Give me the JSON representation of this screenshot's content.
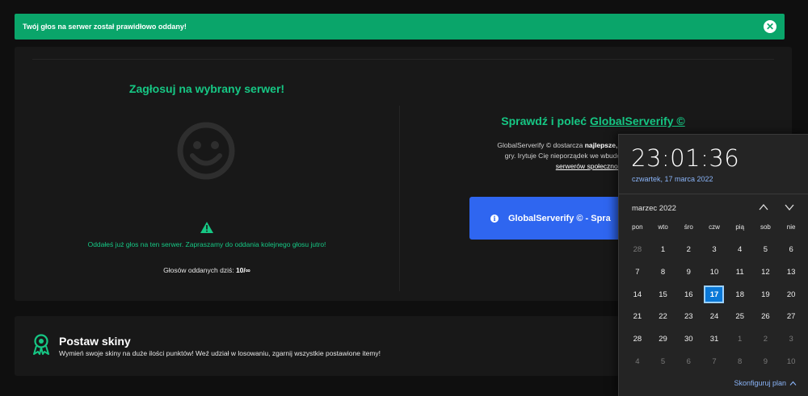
{
  "toast": {
    "message": "Twój głos na serwer został prawidłowo oddany!",
    "close_symbol": "✕"
  },
  "vote": {
    "title": "Zagłosuj na wybrany serwer!",
    "already_voted": "Oddałeś już głos na ten serwer. Zapraszamy do oddania kolejnego głosu jutro!",
    "count_label": "Głosów oddanych dziś:",
    "count_value": "10/∞"
  },
  "promo": {
    "title_prefix": "Sprawdź i poleć",
    "title_link": "GlobalServerify ©",
    "desc_1": "GlobalServerify © dostarcza",
    "desc_bold": "najlepsze, sprawdzone, polskie i",
    "desc_2": "gry. Irytuje Cię nieporządek we wbudowanej wyszukiwarce",
    "desc_link": "serwerów społeczności d",
    "button_label": "GlobalServerify © - Spra"
  },
  "skins": {
    "title": "Postaw skiny",
    "description": "Wymień swoje skiny na duże ilości punktów! Weź udział w losowaniu, zgarnij wszystkie postawione itemy!"
  },
  "calendar": {
    "time": "23:01:36",
    "date": "czwartek, 17 marca 2022",
    "month": "marzec 2022",
    "weekdays": [
      "pon",
      "wto",
      "śro",
      "czw",
      "pią",
      "sob",
      "nie"
    ],
    "days": [
      {
        "d": "28",
        "other": true
      },
      {
        "d": "1"
      },
      {
        "d": "2"
      },
      {
        "d": "3"
      },
      {
        "d": "4"
      },
      {
        "d": "5"
      },
      {
        "d": "6"
      },
      {
        "d": "7"
      },
      {
        "d": "8"
      },
      {
        "d": "9"
      },
      {
        "d": "10"
      },
      {
        "d": "11"
      },
      {
        "d": "12"
      },
      {
        "d": "13"
      },
      {
        "d": "14"
      },
      {
        "d": "15"
      },
      {
        "d": "16"
      },
      {
        "d": "17",
        "today": true
      },
      {
        "d": "18"
      },
      {
        "d": "19"
      },
      {
        "d": "20"
      },
      {
        "d": "21"
      },
      {
        "d": "22"
      },
      {
        "d": "23"
      },
      {
        "d": "24"
      },
      {
        "d": "25"
      },
      {
        "d": "26"
      },
      {
        "d": "27"
      },
      {
        "d": "28"
      },
      {
        "d": "29"
      },
      {
        "d": "30"
      },
      {
        "d": "31"
      },
      {
        "d": "1",
        "other": true
      },
      {
        "d": "2",
        "other": true
      },
      {
        "d": "3",
        "other": true
      },
      {
        "d": "4",
        "other": true
      },
      {
        "d": "5",
        "other": true
      },
      {
        "d": "6",
        "other": true
      },
      {
        "d": "7",
        "other": true
      },
      {
        "d": "8",
        "other": true
      },
      {
        "d": "9",
        "other": true
      },
      {
        "d": "10",
        "other": true
      }
    ],
    "configure": "Skonfiguruj plan"
  },
  "colors": {
    "accent": "#16c784",
    "toast_bg": "#0aa56a",
    "button_bg": "#2f66f0",
    "today_bg": "#0a78d7"
  }
}
